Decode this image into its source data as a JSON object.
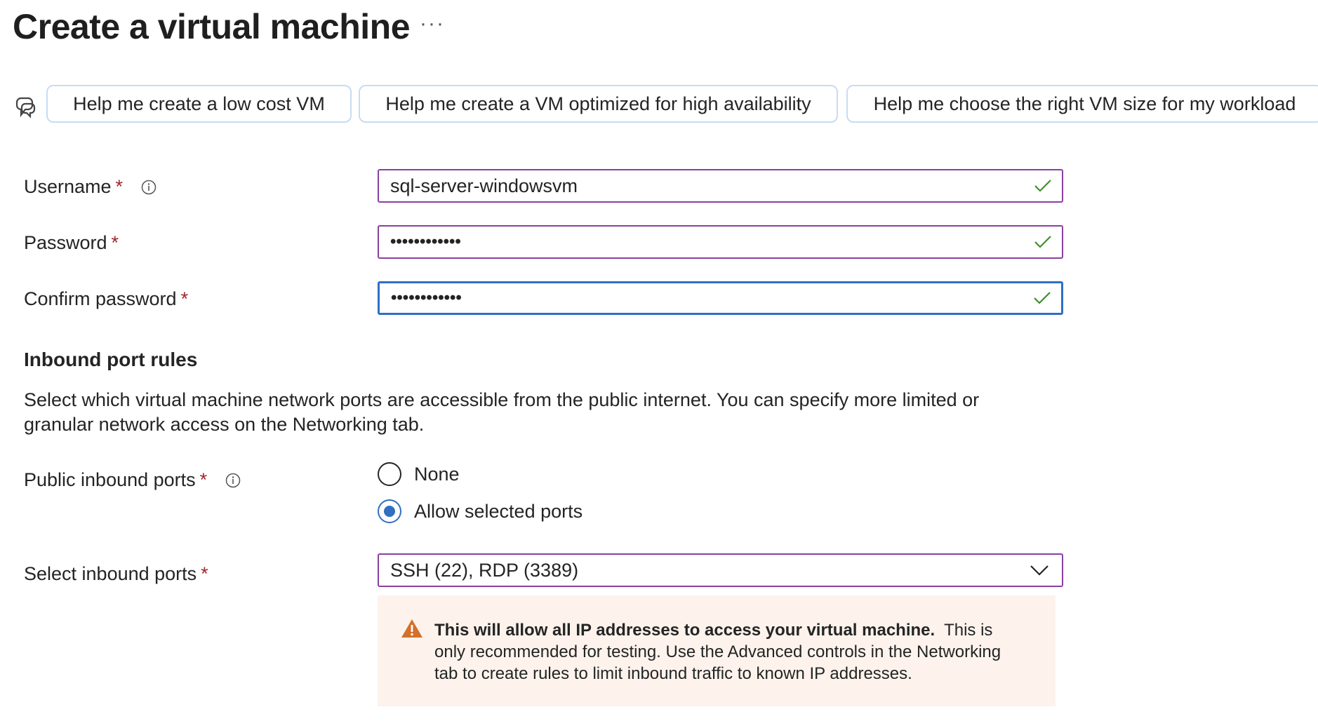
{
  "page": {
    "title": "Create a virtual machine",
    "more_label": "···"
  },
  "copilot": {
    "icon": "copilot-icon",
    "suggestions": [
      "Help me create a low cost VM",
      "Help me create a VM optimized for high availability",
      "Help me choose the right VM size for my workload"
    ]
  },
  "form": {
    "username": {
      "label": "Username",
      "required": "*",
      "value": "sql-server-windowsvm",
      "valid": true
    },
    "password": {
      "label": "Password",
      "required": "*",
      "value": "••••••••••••",
      "valid": true
    },
    "confirm_password": {
      "label": "Confirm password",
      "required": "*",
      "value": "••••••••••••",
      "valid": true
    }
  },
  "inbound": {
    "section_title": "Inbound port rules",
    "description": "Select which virtual machine network ports are accessible from the public internet. You can specify more limited or granular network access on the Networking tab.",
    "public_ports": {
      "label": "Public inbound ports",
      "required": "*",
      "options": [
        "None",
        "Allow selected ports"
      ],
      "selected": "Allow selected ports"
    },
    "select_ports": {
      "label": "Select inbound ports",
      "required": "*",
      "value": "SSH (22), RDP (3389)"
    },
    "warning": {
      "bold": "This will allow all IP addresses to access your virtual machine.",
      "text": "This is only recommended for testing.  Use the Advanced controls in the Networking tab to create rules to limit inbound traffic to known IP addresses."
    }
  },
  "colors": {
    "field_border": "#8a3fa0",
    "focus_border": "#2f6fc4",
    "required": "#a4262c",
    "valid_check": "#3f8f2a",
    "warning_bg": "#fdf3ec",
    "warning_icon": "#d4702a"
  }
}
